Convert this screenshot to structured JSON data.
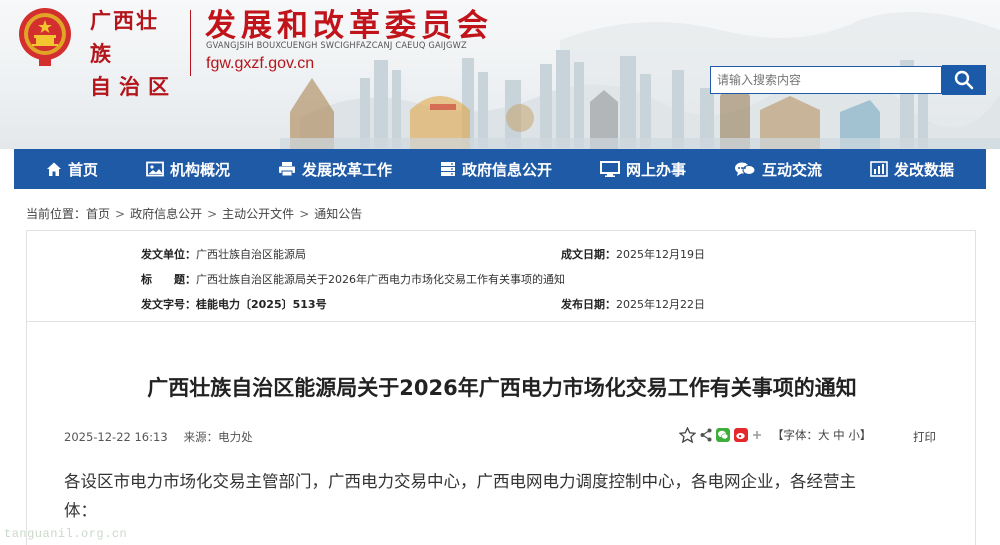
{
  "header": {
    "region_line1": "广西壮族",
    "region_line2": "自治区",
    "org_title": "发展和改革委员会",
    "org_pinyin": "GVANGJSIH BOUXCUENGH SWCIGHFAZCANJ CAEUQ GAIJGWZ",
    "site_url": "fgw.gxzf.gov.cn"
  },
  "search": {
    "placeholder": "请输入搜索内容"
  },
  "nav": {
    "items": [
      {
        "label": "首页",
        "icon": "home-icon"
      },
      {
        "label": "机构概况",
        "icon": "image-icon"
      },
      {
        "label": "发展改革工作",
        "icon": "printer-icon"
      },
      {
        "label": "政府信息公开",
        "icon": "server-icon"
      },
      {
        "label": "网上办事",
        "icon": "monitor-icon"
      },
      {
        "label": "互动交流",
        "icon": "chat-icon"
      },
      {
        "label": "发改数据",
        "icon": "bar-chart-icon"
      }
    ]
  },
  "breadcrumb": {
    "prefix": "当前位置：",
    "items": [
      "首页",
      "政府信息公开",
      "主动公开文件",
      "通知公告"
    ],
    "separator": ">"
  },
  "info": {
    "issuer_label": "发文单位：",
    "issuer_value": "广西壮族自治区能源局",
    "date_label": "成文日期：",
    "date_value": "2025年12月19日",
    "title_label": "标　　题：",
    "title_value": "广西壮族自治区能源局关于2026年广西电力市场化交易工作有关事项的通知",
    "docno_label": "发文字号：",
    "docno_value": "桂能电力〔2025〕513号",
    "pubdate_label": "发布日期：",
    "pubdate_value": "2025年12月22日"
  },
  "article": {
    "title": "广西壮族自治区能源局关于2026年广西电力市场化交易工作有关事项的通知",
    "datetime": "2025-12-22 16:13",
    "source": "来源：电力处",
    "font_label": "【字体：",
    "font_sizes": [
      "大",
      "中",
      "小"
    ],
    "font_close": "】",
    "print": "打印",
    "body_line1": "各设区市电力市场化交易主管部门，广西电力交易中心，广西电网电力调度控制中心，各电网企业，各经营主",
    "body_line2": "体："
  },
  "watermark": "tanguanil.org.cn",
  "colors": {
    "brand_red": "#c0131a",
    "nav_blue": "#1f5aa6",
    "search_blue": "#1a5aa8"
  }
}
